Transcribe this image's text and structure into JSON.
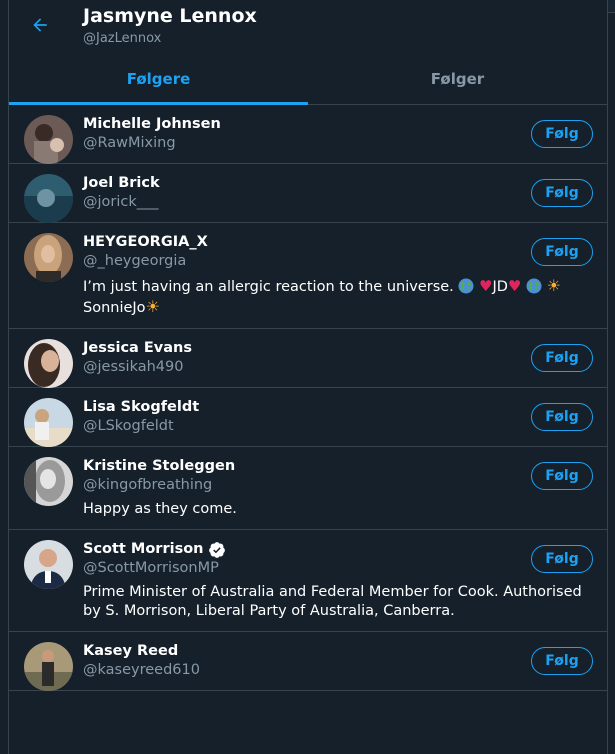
{
  "header": {
    "title": "Jasmyne Lennox",
    "handle": "@JazLennox"
  },
  "tabs": [
    {
      "label": "Følgere",
      "active": true
    },
    {
      "label": "Følger",
      "active": false
    }
  ],
  "follow_label": "Følg",
  "users": [
    {
      "name": "Michelle Johnsen",
      "handle": "@RawMixing",
      "bio": "",
      "verified": false
    },
    {
      "name": "Joel Brick",
      "handle": "@jorick___",
      "bio": "",
      "verified": false
    },
    {
      "name": "HEYGEORGIA_X",
      "handle": "@_heygeorgia",
      "bio_parts": {
        "text": "I’m just having an allergic reaction to the universe.",
        "jd": "JD",
        "tail": "SonnieJo"
      },
      "verified": false
    },
    {
      "name": "Jessica Evans",
      "handle": "@jessikah490",
      "bio": "",
      "verified": false
    },
    {
      "name": "Lisa Skogfeldt",
      "handle": "@LSkogfeldt",
      "bio": "",
      "verified": false
    },
    {
      "name": "Kristine Stoleggen",
      "handle": "@kingofbreathing",
      "bio": "Happy as they come.",
      "verified": false
    },
    {
      "name": "Scott Morrison",
      "handle": "@ScottMorrisonMP",
      "bio": "Prime Minister of Australia and Federal Member for Cook. Authorised by S. Morrison, Liberal Party of Australia, Canberra.",
      "verified": true
    },
    {
      "name": "Kasey Reed",
      "handle": "@kaseyreed610",
      "bio": "",
      "verified": false
    }
  ],
  "colors": {
    "background": "#15202b",
    "accent": "#1da1f2",
    "border": "#38444d",
    "secondary_text": "#8899a6"
  }
}
